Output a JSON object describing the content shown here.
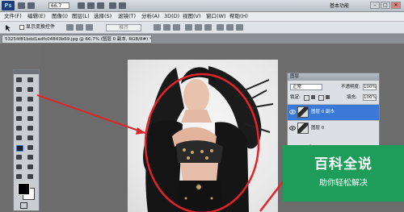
{
  "app": {
    "logo_text": "Ps",
    "zoom_value": "66.7",
    "workspace_label": "基本功能",
    "window_buttons": [
      "–",
      "□",
      "✕"
    ]
  },
  "menu": [
    "文件(F)",
    "编辑(E)",
    "图像(I)",
    "图层(L)",
    "选择(S)",
    "滤镜(T)",
    "分析(A)",
    "3D(D)",
    "视图(V)",
    "窗口(W)",
    "帮助(H)"
  ],
  "options_bar": {
    "checkbox_label": "显示变换控件",
    "align_button": "堆齐"
  },
  "document": {
    "tab_title": "53254f81bdd1adfc04843b69.jpg @ 66.7% (图层 0 副本, RGB/8#) *"
  },
  "layers_panel": {
    "title": "图层",
    "blend_mode": "正常",
    "opacity_label": "不透明度:",
    "opacity_value": "100%",
    "lock_label": "锁定:",
    "fill_label": "填充:",
    "fill_value": "100%",
    "layers": [
      {
        "name": "图层 0 副本",
        "selected": true
      },
      {
        "name": "图层 0",
        "selected": false
      }
    ]
  },
  "watermark": {
    "title": "百科全说",
    "subtitle": "助你轻松解决"
  },
  "annotation": {
    "color": "#e0242a"
  },
  "colors": {
    "selection": "#3a79d6",
    "watermark_bg": "#1e9d5a"
  }
}
